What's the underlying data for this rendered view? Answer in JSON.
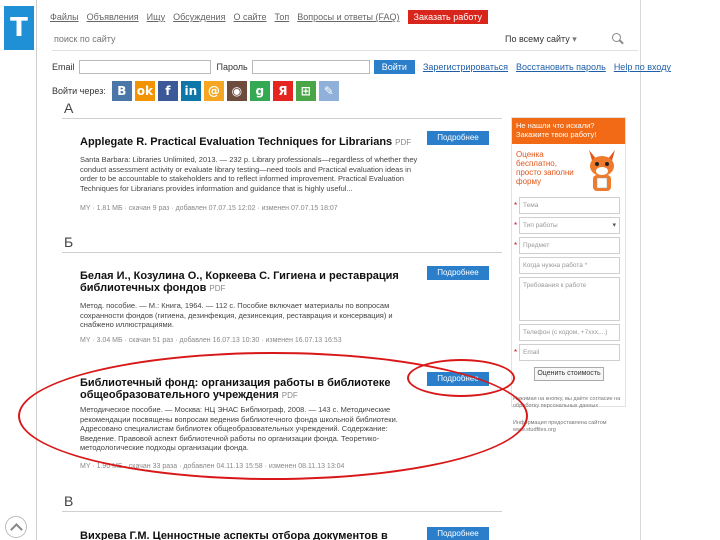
{
  "header": {
    "logo": "T",
    "nav": [
      "Файлы",
      "Объявления",
      "Ищу",
      "Обсуждения",
      "О сайте",
      "Топ",
      "Вопросы и ответы (FAQ)"
    ],
    "cta": "Заказать работу",
    "search_placeholder": "поиск по сайту",
    "search_scope": "По всему сайту"
  },
  "login": {
    "email_label": "Email",
    "password_label": "Пароль",
    "submit": "Войти",
    "register": "Зарегистрироваться",
    "restore": "Восстановить пароль",
    "help": "Help по входу",
    "social_label": "Войти через:"
  },
  "social": [
    {
      "name": "vk-icon",
      "glyph": "B",
      "color": "#4a76a8"
    },
    {
      "name": "odnoklassniki-icon",
      "glyph": "ok",
      "color": "#f29400"
    },
    {
      "name": "facebook-icon",
      "glyph": "f",
      "color": "#3b5998"
    },
    {
      "name": "linkedin-icon",
      "glyph": "in",
      "color": "#0e76a8"
    },
    {
      "name": "mailru-icon",
      "glyph": "@",
      "color": "#f5a623"
    },
    {
      "name": "instagram-icon",
      "glyph": "◉",
      "color": "#6d4c3d"
    },
    {
      "name": "google-icon",
      "glyph": "g",
      "color": "#34a853"
    },
    {
      "name": "yandex-icon",
      "glyph": "Я",
      "color": "#e52620"
    },
    {
      "name": "windows-icon",
      "glyph": "⊞",
      "color": "#4aa546"
    },
    {
      "name": "openid-icon",
      "glyph": "✎",
      "color": "#8fb0d8"
    }
  ],
  "sections": [
    {
      "letter": "А"
    },
    {
      "letter": "Б"
    },
    {
      "letter": "В"
    }
  ],
  "cards": [
    {
      "title": "Applegate R. Practical Evaluation Techniques for Librarians",
      "format": "PDF",
      "desc": "Santa Barbara: Libraries Unlimited, 2013. — 232 p. Library professionals—regardless of whether they conduct assessment activity or evaluate library testing—need tools and Practical evaluation ideas in order to be accountable to stakeholders and to reflect informed improvement. Practical Evaluation Techniques for Librarians provides information and guidance that is highly useful...",
      "meta": "MY · 1.81 МБ · скачан 9 раз · добавлен 07.07.15 12:02 · изменен 07.07.15 18:07",
      "more": "Подробнее"
    },
    {
      "title": "Белая И., Козулина О., Коркеева С. Гигиена и реставрация библиотечных фондов",
      "format": "PDF",
      "desc": "Метод. пособие. — М.: Книга, 1964. — 112 с. Пособие включает материалы по вопросам сохранности фондов (гигиена, дезинфекция, дезинсекция, реставрация и консервация) и снабжено иллюстрациями.",
      "meta": "MY · 3.04 МБ · скачан 51 раз · добавлен 16.07.13 10:30 · изменен 16.07.13 16:53",
      "more": "Подробнее"
    },
    {
      "title": "Библиотечный фонд: организация работы в библиотеке общеобразовательного учреждения",
      "format": "PDF",
      "desc": "Методическое пособие. — Москва: НЦ ЭНАС Библиограф, 2008. — 143 с. Методические рекомендации посвящены вопросам ведения библиотечного фонда школьной библиотеки. Адресовано специалистам библиотек общеобразовательных учреждений. Содержание: Введение. Правовой аспект библиотечной работы по организации фонда. Теоретико-методологические подходы организации фонда.",
      "meta": "MY · 1.90 МБ · скачан 33 раза · добавлен 04.11.13 15:58 · изменен 08.11.13 13:04",
      "more": "Подробнее"
    },
    {
      "title": "Вихрева Г.М. Ценностные аспекты отбора документов в",
      "more": "Подробнее"
    }
  ],
  "sidebar": {
    "header": "Не нашли что искали? Закажите твою работу!",
    "promo": "Оценка бесплатно, просто заполни форму",
    "fields": [
      {
        "placeholder": "Тема",
        "required": true
      },
      {
        "placeholder": "Тип работы",
        "required": true,
        "dropdown": true
      },
      {
        "placeholder": "Предмет",
        "required": true
      },
      {
        "placeholder": "Когда нужна работа *",
        "required": false
      },
      {
        "placeholder": "Требования к работе",
        "required": false,
        "tall": true
      },
      {
        "placeholder": "Телефон (с кодом, +7ххх,...)",
        "required": false
      },
      {
        "placeholder": "Email",
        "required": true
      }
    ],
    "submit": "Оценить стоимость",
    "note1": "Нажимая на кнопку, вы даёте согласие на обработку персональных данных",
    "note2": "Информация предоставлена сайтом www.studfiles.org"
  }
}
